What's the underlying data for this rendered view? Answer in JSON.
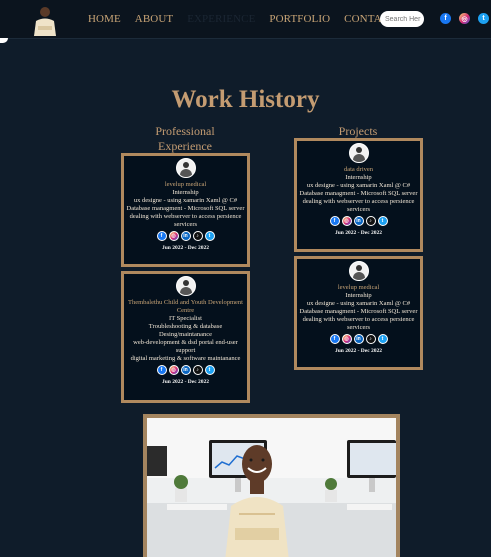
{
  "nav": {
    "links": [
      "HOME",
      "ABOUT",
      "EXPERIENCE",
      "PORTFOLIO",
      "CONTACT"
    ],
    "search_placeholder": "Search Her",
    "social_icons": [
      "facebook-icon",
      "instagram-icon",
      "twitter-icon"
    ]
  },
  "page": {
    "title": "Work History"
  },
  "sections": {
    "professional_heading": "Professional Experience",
    "projects_heading": "Projects"
  },
  "professional": [
    {
      "org": "levelup medical",
      "role": "Internship",
      "lines": [
        "ux designe - using xamarin Xaml @ C#",
        "Database managment - Microsoft SQL server",
        "dealing with webserver to access persience servicers"
      ],
      "dates": "Jun 2022 - Dec 2022"
    },
    {
      "org": "Thembalethu Child and Youth Development Centre",
      "role": "IT Specialist",
      "lines": [
        "Troubleshooting & database Desing/maintanance",
        "web-development & dsd portal end-user support",
        "digital marketing & software maintanance"
      ],
      "dates": "Jun 2022 - Dec 2022"
    }
  ],
  "projects": [
    {
      "org": "data driven",
      "role": "Internship",
      "lines": [
        "ux designe - using xamarin Xaml @ C#",
        "Database managment - Microsoft SQL server",
        "dealing with webserver to access persience servicers"
      ],
      "dates": "Jun 2022 - Dec 2022"
    },
    {
      "org": "levelup medical",
      "role": "Internship",
      "lines": [
        "ux designe - using xamarin Xaml @ C#",
        "Database managment - Microsoft SQL server",
        "dealing with webserver to access persience servicers"
      ],
      "dates": "Jun 2022 - Dec 2022"
    }
  ],
  "card_social_icons": [
    "facebook-icon",
    "instagram-icon",
    "linkedin-icon",
    "tiktok-icon",
    "twitter-icon"
  ],
  "colors": {
    "accent": "#c49c72",
    "background": "#0f1c2a",
    "card_border": "#b0895e"
  }
}
